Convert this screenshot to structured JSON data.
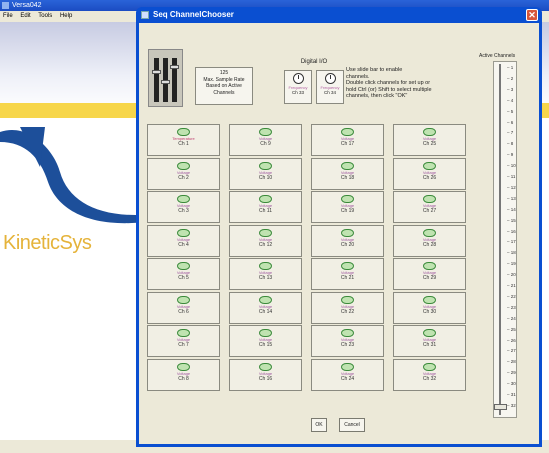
{
  "bg": {
    "title": "Versa042",
    "menu": [
      "File",
      "Edit",
      "Tools",
      "Help"
    ],
    "logo_text": "KineticSys"
  },
  "dialog": {
    "title": "Seq ChannelChooser",
    "max_btn_lines": [
      "125",
      "Max. Sample Rate",
      "Based on Active",
      "Channels"
    ],
    "digital_io": "Digital I/O",
    "digital_channels": [
      {
        "type": "Frequency",
        "ch": "Ch 33"
      },
      {
        "type": "Frequency",
        "ch": "Ch 34"
      }
    ],
    "hint_lines": [
      "Use slide bar to enable",
      "channels.",
      "Double click channels for set up or",
      "hold Ctrl (or) Shift to select multiple",
      "channels, then click \"OK\""
    ],
    "active_label": "Active Channels",
    "ticks": [
      "1",
      "2",
      "3",
      "4",
      "5",
      "6",
      "7",
      "8",
      "9",
      "10",
      "11",
      "12",
      "13",
      "14",
      "15",
      "16",
      "17",
      "18",
      "19",
      "20",
      "21",
      "22",
      "23",
      "24",
      "25",
      "26",
      "27",
      "28",
      "29",
      "30",
      "31",
      "32"
    ],
    "ok": "OK",
    "cancel": "Cancel",
    "channels": [
      {
        "type": "Temperature",
        "ch": "Ch 1"
      },
      {
        "type": "Voltage",
        "ch": "Ch 9"
      },
      {
        "type": "Voltage",
        "ch": "Ch 17"
      },
      {
        "type": "Voltage",
        "ch": "Ch 25"
      },
      {
        "type": "Voltage",
        "ch": "Ch 2"
      },
      {
        "type": "Voltage",
        "ch": "Ch 10"
      },
      {
        "type": "Voltage",
        "ch": "Ch 18"
      },
      {
        "type": "Voltage",
        "ch": "Ch 26"
      },
      {
        "type": "Voltage",
        "ch": "Ch 3"
      },
      {
        "type": "Voltage",
        "ch": "Ch 11"
      },
      {
        "type": "Voltage",
        "ch": "Ch 19"
      },
      {
        "type": "Voltage",
        "ch": "Ch 27"
      },
      {
        "type": "Voltage",
        "ch": "Ch 4"
      },
      {
        "type": "Voltage",
        "ch": "Ch 12"
      },
      {
        "type": "Voltage",
        "ch": "Ch 20"
      },
      {
        "type": "Voltage",
        "ch": "Ch 28"
      },
      {
        "type": "Voltage",
        "ch": "Ch 5"
      },
      {
        "type": "Voltage",
        "ch": "Ch 13"
      },
      {
        "type": "Voltage",
        "ch": "Ch 21"
      },
      {
        "type": "Voltage",
        "ch": "Ch 29"
      },
      {
        "type": "Voltage",
        "ch": "Ch 6"
      },
      {
        "type": "Voltage",
        "ch": "Ch 14"
      },
      {
        "type": "Voltage",
        "ch": "Ch 22"
      },
      {
        "type": "Voltage",
        "ch": "Ch 30"
      },
      {
        "type": "Voltage",
        "ch": "Ch 7"
      },
      {
        "type": "Voltage",
        "ch": "Ch 15"
      },
      {
        "type": "Voltage",
        "ch": "Ch 23"
      },
      {
        "type": "Voltage",
        "ch": "Ch 31"
      },
      {
        "type": "Voltage",
        "ch": "Ch 8"
      },
      {
        "type": "Voltage",
        "ch": "Ch 16"
      },
      {
        "type": "Voltage",
        "ch": "Ch 24"
      },
      {
        "type": "Voltage",
        "ch": "Ch 32"
      }
    ]
  }
}
